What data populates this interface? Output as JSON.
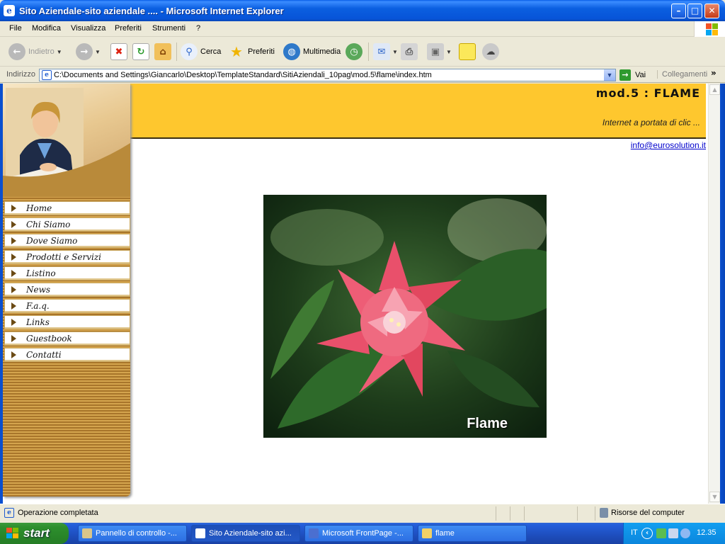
{
  "window": {
    "title": "Sito Aziendale-sito aziendale .... - Microsoft Internet Explorer",
    "minimize": "–",
    "maximize": "□",
    "close": "✕"
  },
  "menu": [
    "File",
    "Modifica",
    "Visualizza",
    "Preferiti",
    "Strumenti",
    "?"
  ],
  "toolbar": {
    "back": "Indietro",
    "search": "Cerca",
    "favorites": "Preferiti",
    "media": "Multimedia"
  },
  "address": {
    "label": "Indirizzo",
    "url": "C:\\Documents and Settings\\Giancarlo\\Desktop\\TemplateStandard\\SitiAziendali_10pag\\mod.5\\flame\\index.htm",
    "go": "Vai",
    "links": "Collegamenti"
  },
  "page": {
    "title": "mod.5  :  FLAME",
    "tagline": "Internet a portata di clic ...",
    "email": "info@eurosolution.it",
    "image_caption": "Flame",
    "nav": [
      "Home",
      "Chi Siamo",
      "Dove Siamo",
      "Prodotti e Servizi",
      "Listino",
      "News",
      "F.a.q.",
      "Links",
      "Guestbook",
      "Contatti"
    ]
  },
  "status": {
    "text": "Operazione completata",
    "zone": "Risorse del computer"
  },
  "taskbar": {
    "start": "start",
    "tasks": [
      "Pannello di controllo -...",
      "Sito Aziendale-sito azi...",
      "Microsoft FrontPage -...",
      "flame"
    ],
    "lang": "IT",
    "clock": "12.35"
  },
  "colors": {
    "header_band": "#fec72e",
    "sidebar_brown": "#a8752a",
    "link_blue": "#0000cc"
  }
}
